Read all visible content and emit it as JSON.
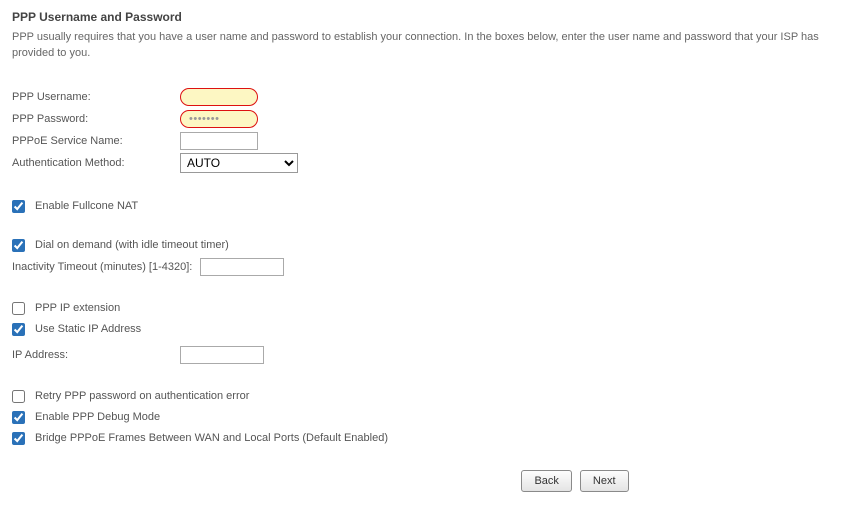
{
  "title": "PPP Username and Password",
  "desc": "PPP usually requires that you have a user name and password to establish your connection. In the boxes below, enter the user name and password that your ISP has provided to you.",
  "fields": {
    "username_label": "PPP Username:",
    "username_value": "",
    "password_label": "PPP Password:",
    "password_value": "•••••••",
    "service_label": "PPPoE Service Name:",
    "service_value": "",
    "auth_label": "Authentication Method:",
    "auth_value": "AUTO"
  },
  "options": {
    "fullcone": {
      "label": "Enable Fullcone NAT",
      "checked": true
    },
    "dial": {
      "label": "Dial on demand (with idle timeout timer)",
      "checked": true
    },
    "inactivity_label": "Inactivity Timeout (minutes) [1-4320]:",
    "inactivity_value": "",
    "pppip": {
      "label": "PPP IP extension",
      "checked": false
    },
    "staticip": {
      "label": "Use Static IP Address",
      "checked": true
    },
    "ip_label": "IP Address:",
    "ip_value": "",
    "retry": {
      "label": "Retry PPP password on authentication error",
      "checked": false
    },
    "debug": {
      "label": "Enable PPP Debug Mode",
      "checked": true
    },
    "bridge": {
      "label": "Bridge PPPoE Frames Between WAN and Local Ports (Default Enabled)",
      "checked": true
    }
  },
  "buttons": {
    "back": "Back",
    "next": "Next"
  }
}
